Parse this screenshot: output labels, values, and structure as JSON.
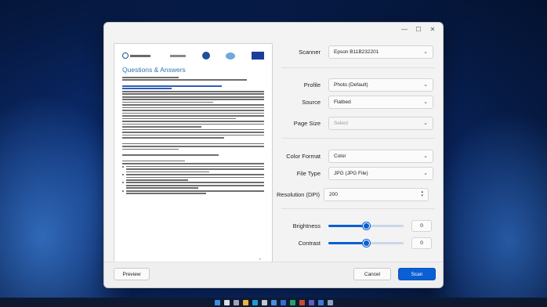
{
  "window": {
    "controls": {
      "minimize": "—",
      "maximize": "☐",
      "close": "✕"
    }
  },
  "document": {
    "title": "Questions & Answers",
    "page_number": "1"
  },
  "settings": {
    "scanner": {
      "label": "Scanner",
      "value": "Epson B11B232201"
    },
    "profile": {
      "label": "Profile",
      "value": "Photo (Default)"
    },
    "source": {
      "label": "Source",
      "value": "Flatbed"
    },
    "page_size": {
      "label": "Page Size",
      "value": "Select"
    },
    "color_format": {
      "label": "Color Format",
      "value": "Color"
    },
    "file_type": {
      "label": "File Type",
      "value": "JPG (JPG File)"
    },
    "resolution": {
      "label": "Resolution (DPI)",
      "value": "200"
    },
    "brightness": {
      "label": "Brightness",
      "value": "0",
      "level": 0.5
    },
    "contrast": {
      "label": "Contrast",
      "value": "0",
      "level": 0.5
    }
  },
  "buttons": {
    "preview": "Preview",
    "cancel": "Cancel",
    "scan": "Scan"
  },
  "colors": {
    "accent": "#0a5fd3",
    "doc_heading": "#2e75b6"
  }
}
